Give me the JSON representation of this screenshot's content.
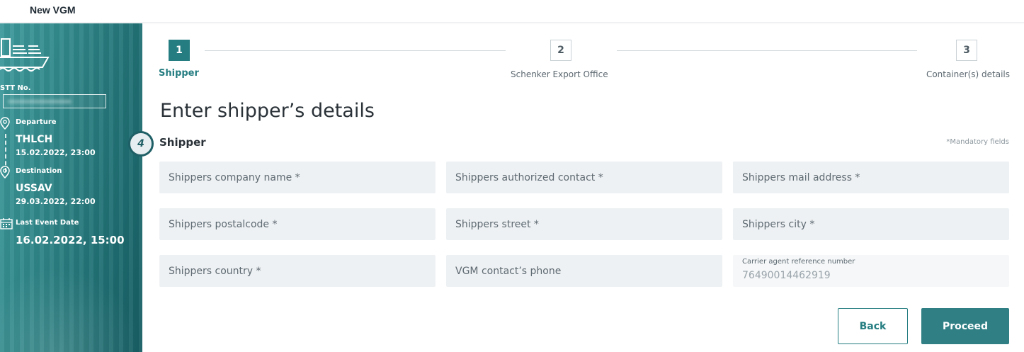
{
  "header": {
    "title": "New VGM"
  },
  "sidebar": {
    "stt_label": "STT No.",
    "departure_label": "Departure",
    "departure_code": "THLCH",
    "departure_date": "15.02.2022, 23:00",
    "destination_label": "Destination",
    "destination_code": "USSAV",
    "destination_date": "29.03.2022, 22:00",
    "last_event_label": "Last Event Date",
    "last_event_date": "16.02.2022, 15:00"
  },
  "stepper": {
    "steps": [
      {
        "number": "1",
        "label": "Shipper",
        "active": true
      },
      {
        "number": "2",
        "label": "Schenker Export Office",
        "active": false
      },
      {
        "number": "3",
        "label": "Container(s) details",
        "active": false
      }
    ]
  },
  "form": {
    "page_title": "Enter shipper’s details",
    "section_number": "4",
    "section_title": "Shipper",
    "mandatory_note": "*Mandatory fields",
    "fields": {
      "company_name": "Shippers company name *",
      "authorized_contact": "Shippers authorized contact *",
      "mail_address": "Shippers mail address *",
      "postalcode": "Shippers postalcode *",
      "street": "Shippers street *",
      "city": "Shippers city *",
      "country": "Shippers country *",
      "vgm_phone": "VGM contact’s phone"
    },
    "carrier_ref": {
      "label": "Carrier agent reference number",
      "value": "76490014462919"
    }
  },
  "actions": {
    "back": "Back",
    "proceed": "Proceed"
  },
  "colors": {
    "accent": "#257d81",
    "field_bg": "#eef1f3",
    "sidebar": "#2f8587"
  }
}
